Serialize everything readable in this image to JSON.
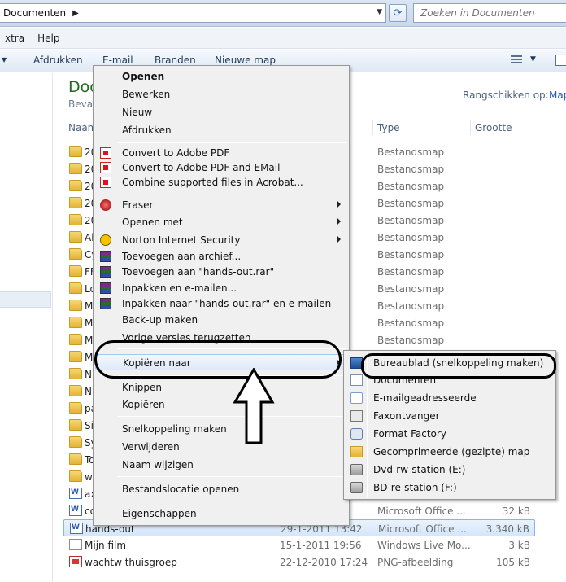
{
  "address_bar": {
    "breadcrumb": "Documenten",
    "separator": "▶",
    "dropdown": "▼",
    "refresh": "⟳",
    "search_placeholder": "Zoeken in Documenten"
  },
  "menubar": {
    "items": [
      "xtra",
      "Help"
    ]
  },
  "toolbar": {
    "items": [
      "Afdrukken",
      "E-mail",
      "Branden",
      "Nieuwe map"
    ],
    "lead_arrow": "▼",
    "view_drop": "▼"
  },
  "library": {
    "title": "Doc",
    "subtitle": "Bevat",
    "arrange_label": "Rangschikken op:",
    "arrange_value": "Map"
  },
  "columns": {
    "name": "Naam",
    "type": "Type",
    "size": "Grootte"
  },
  "rows": [
    {
      "name": "20",
      "date": "",
      "type": "Bestandsmap",
      "size": ""
    },
    {
      "name": "20",
      "date": "",
      "type": "Bestandsmap",
      "size": ""
    },
    {
      "name": "20",
      "date": "",
      "type": "Bestandsmap",
      "size": ""
    },
    {
      "name": "20",
      "date": "",
      "type": "Bestandsmap",
      "size": ""
    },
    {
      "name": "20",
      "date": "",
      "type": "Bestandsmap",
      "size": ""
    },
    {
      "name": "Al",
      "date": "",
      "type": "Bestandsmap",
      "size": ""
    },
    {
      "name": "Cy",
      "date": "",
      "type": "Bestandsmap",
      "size": ""
    },
    {
      "name": "FF",
      "date": "",
      "type": "Bestandsmap",
      "size": ""
    },
    {
      "name": "Lo",
      "date": "",
      "type": "Bestandsmap",
      "size": ""
    },
    {
      "name": "M",
      "date": "",
      "type": "Bestandsmap",
      "size": ""
    },
    {
      "name": "M",
      "date": "",
      "type": "Bestandsmap",
      "size": ""
    },
    {
      "name": "M",
      "date": "",
      "type": "Bestandsmap",
      "size": ""
    },
    {
      "name": "M",
      "date": "",
      "type": "",
      "size": ""
    },
    {
      "name": "N",
      "date": "",
      "type": "",
      "size": ""
    },
    {
      "name": "N",
      "date": "",
      "type": "",
      "size": ""
    },
    {
      "name": "pa",
      "date": "",
      "type": "",
      "size": ""
    },
    {
      "name": "Si",
      "date": "",
      "type": "",
      "size": ""
    },
    {
      "name": "Sy",
      "date": "",
      "type": "",
      "size": ""
    },
    {
      "name": "To",
      "date": "",
      "type": "",
      "size": ""
    },
    {
      "name": "w",
      "date": "",
      "type": "",
      "size": ""
    },
    {
      "name": "ax",
      "date": "",
      "type": "",
      "size": ""
    },
    {
      "name": "co",
      "date": "",
      "type": "Microsoft Office ...",
      "size": "32 kB"
    },
    {
      "name": "hands-out",
      "date": "29-1-2011 13:42",
      "type": "Microsoft Office ...",
      "size": "3.340 kB"
    },
    {
      "name": "Mijn film",
      "date": "15-1-2011 19:56",
      "type": "Windows Live Mo...",
      "size": "3 kB"
    },
    {
      "name": "wachtw thuisgroep",
      "date": "22-12-2010 17:24",
      "type": "PNG-afbeelding",
      "size": "105 kB"
    }
  ],
  "context_menu": {
    "items": [
      {
        "label": "Openen"
      },
      {
        "label": "Bewerken"
      },
      {
        "label": "Nieuw"
      },
      {
        "label": "Afdrukken"
      },
      {
        "label": "Convert to Adobe PDF"
      },
      {
        "label": "Convert to Adobe PDF and EMail"
      },
      {
        "label": "Combine supported files in Acrobat..."
      },
      {
        "label": "Eraser"
      },
      {
        "label": "Openen met"
      },
      {
        "label": "Norton Internet Security"
      },
      {
        "label": "Toevoegen aan archief..."
      },
      {
        "label": "Toevoegen aan \"hands-out.rar\""
      },
      {
        "label": "Inpakken en e-mailen..."
      },
      {
        "label": "Inpakken naar \"hands-out.rar\" en e-mailen"
      },
      {
        "label": "Back-up maken"
      },
      {
        "label": "Vorige versies terugzetten"
      },
      {
        "label": "Kopiëren naar"
      },
      {
        "label": "Knippen"
      },
      {
        "label": "Kopiëren"
      },
      {
        "label": "Snelkoppeling maken"
      },
      {
        "label": "Verwijderen"
      },
      {
        "label": "Naam wijzigen"
      },
      {
        "label": "Bestandslocatie openen"
      },
      {
        "label": "Eigenschappen"
      }
    ]
  },
  "submenu": {
    "items": [
      {
        "label": "Bureaublad (snelkoppeling maken)"
      },
      {
        "label": "Documenten"
      },
      {
        "label": "E-mailgeadresseerde"
      },
      {
        "label": "Faxontvanger"
      },
      {
        "label": "Format Factory"
      },
      {
        "label": "Gecomprimeerde (gezipte) map"
      },
      {
        "label": "Dvd-rw-station (E:)"
      },
      {
        "label": "BD-re-station (F:)"
      }
    ]
  },
  "colors": {
    "selection": "#d4e6fb",
    "library_title": "#1e6b1e",
    "link": "#1f5bb8",
    "annotation": "#000000"
  },
  "icons": {
    "folder": "folder-icon",
    "word": "word-document-icon",
    "video": "video-project-icon",
    "image": "png-image-icon"
  }
}
